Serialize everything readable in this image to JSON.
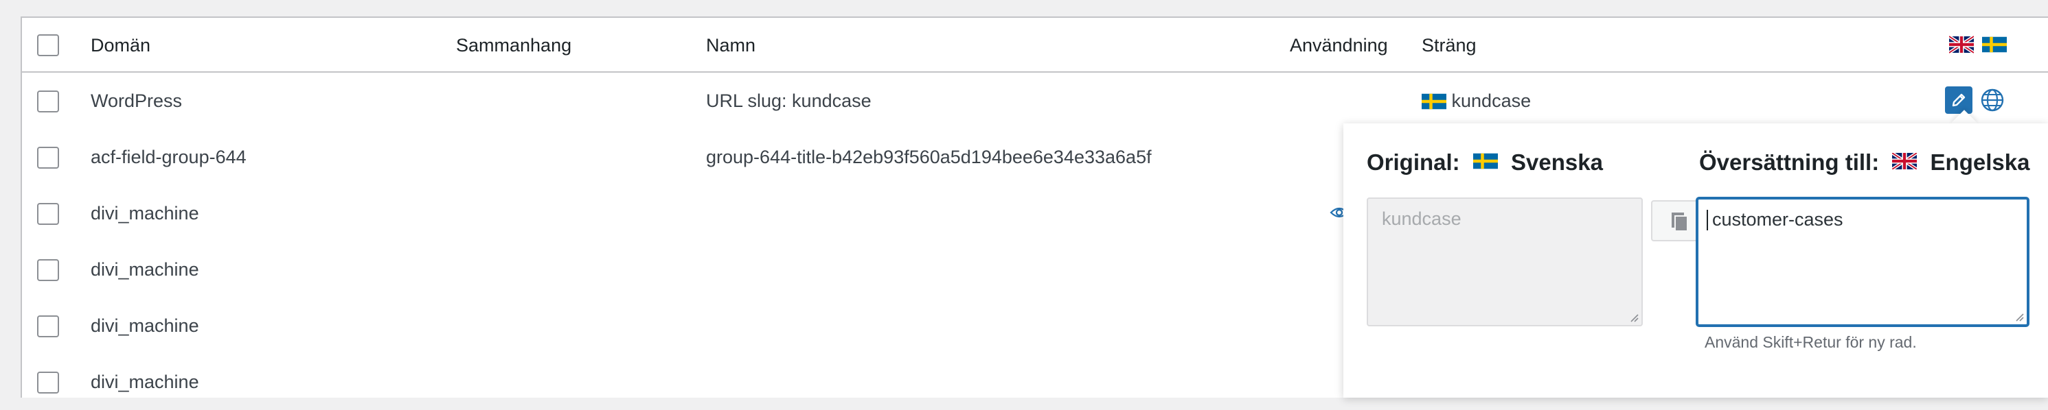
{
  "columns": {
    "domain": "Domän",
    "context": "Sammanhang",
    "name": "Namn",
    "usage": "Användning",
    "string": "Sträng"
  },
  "header_flags": [
    "flag-uk-icon",
    "flag-sweden-icon"
  ],
  "rows": [
    {
      "domain": "WordPress",
      "context": "",
      "name": "URL slug: kundcase",
      "string": "kundcase",
      "string_flag": "flag-sweden-icon"
    },
    {
      "domain": "acf-field-group-644",
      "context": "",
      "name": "group-644-title-b42eb93f560a5d194bee6e34e33a6a5f",
      "string": ""
    },
    {
      "domain": "divi_machine",
      "context": "",
      "name": "",
      "string": ""
    },
    {
      "domain": "divi_machine",
      "context": "",
      "name": "",
      "string": ""
    },
    {
      "domain": "divi_machine",
      "context": "",
      "name": "",
      "string": ""
    },
    {
      "domain": "divi_machine",
      "context": "",
      "name": "",
      "string": ""
    }
  ],
  "popover": {
    "original_label": "Original:",
    "original_language": "Svenska",
    "translation_label": "Översättning till:",
    "translation_language": "Engelska",
    "original_text": "kundcase",
    "translation_text": "customer-cases",
    "hint": "Använd Skift+Retur för ny rad."
  },
  "colors": {
    "accent": "#2271b1",
    "border": "#c3c4c7",
    "background": "#f0f0f1"
  }
}
